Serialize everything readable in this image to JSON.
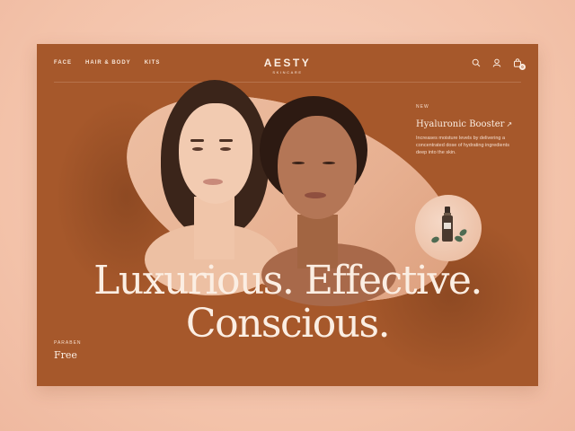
{
  "nav": {
    "items": [
      "FACE",
      "HAIR & BODY",
      "KITS"
    ]
  },
  "brand": {
    "name": "AESTY",
    "tagline": "SKINCARE"
  },
  "header_icons": [
    "search-icon",
    "user-icon",
    "shopping-bag-icon"
  ],
  "cart": {
    "count": "0"
  },
  "hero": {
    "headline_line1": "Luxurious. Effective.",
    "headline_line2": "Conscious."
  },
  "product": {
    "badge": "NEW",
    "name": "Hyaluronic Booster",
    "description": "Increases moisture levels by delivering a concentrated dose of hydrating ingredients deep into the skin."
  },
  "feature": {
    "label": "PARABEN",
    "value": "Free"
  },
  "colors": {
    "page_background": "#f6c9b2",
    "card_background": "#a6582b",
    "text_light": "#fbeee3"
  }
}
